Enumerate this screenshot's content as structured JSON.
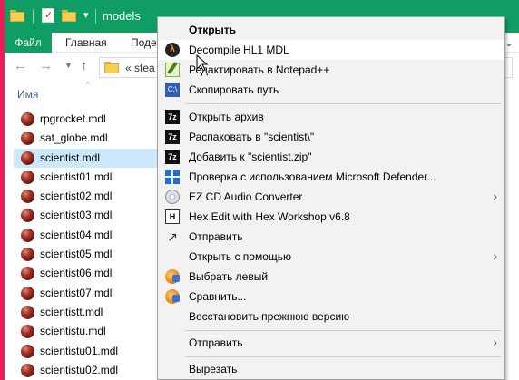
{
  "window": {
    "title": "models",
    "ribbon_tabs": [
      "Файл",
      "Главная",
      "Поде"
    ],
    "address_text": "«  stea",
    "column_header": "Имя",
    "controls": {
      "minimize": "—",
      "maximize": "☐",
      "close": "✕"
    }
  },
  "files": [
    "rpgrocket.mdl",
    "sat_globe.mdl",
    "scientist.mdl",
    "scientist01.mdl",
    "scientist02.mdl",
    "scientist03.mdl",
    "scientist04.mdl",
    "scientist05.mdl",
    "scientist06.mdl",
    "scientist07.mdl",
    "scientistt.mdl",
    "scientistu.mdl",
    "scientistu01.mdl",
    "scientistu02.mdl"
  ],
  "selected_file": "scientist.mdl",
  "context_menu": {
    "items": [
      {
        "label": "Открыть",
        "bold": true,
        "icon": "none"
      },
      {
        "label": "Decompile HL1 MDL",
        "icon": "half-life-icon",
        "hover": true
      },
      {
        "label": "Редактировать в Notepad++",
        "icon": "notepadpp-icon"
      },
      {
        "label": "Скопировать путь",
        "icon": "copy-path-icon"
      },
      {
        "label": "Открыть архив",
        "icon": "7zip-icon"
      },
      {
        "label": "Распаковать в \"scientist\\\"",
        "icon": "7zip-icon"
      },
      {
        "label": "Добавить к \"scientist.zip\"",
        "icon": "7zip-icon"
      },
      {
        "label": "Проверка с использованием Microsoft Defender...",
        "icon": "defender-icon"
      },
      {
        "label": "EZ CD Audio Converter",
        "icon": "cd-icon",
        "submenu": true
      },
      {
        "label": "Hex Edit with Hex Workshop v6.8",
        "icon": "hex-workshop-icon"
      },
      {
        "label": "Отправить",
        "icon": "share-icon"
      },
      {
        "label": "Открыть с помощью",
        "icon": "none",
        "submenu": true
      },
      {
        "label": "Выбрать левый",
        "icon": "compare-icon"
      },
      {
        "label": "Сравнить...",
        "icon": "compare-icon"
      },
      {
        "label": "Восстановить прежнюю версию",
        "icon": "none"
      },
      {
        "label": "Отправить",
        "icon": "none",
        "submenu": true
      },
      {
        "label": "Вырезать",
        "icon": "none"
      }
    ]
  },
  "colors": {
    "titlebar": "#0f9d63",
    "background": "#e51f57",
    "selection": "#cce8ff",
    "menu": "#f2f2f2"
  }
}
